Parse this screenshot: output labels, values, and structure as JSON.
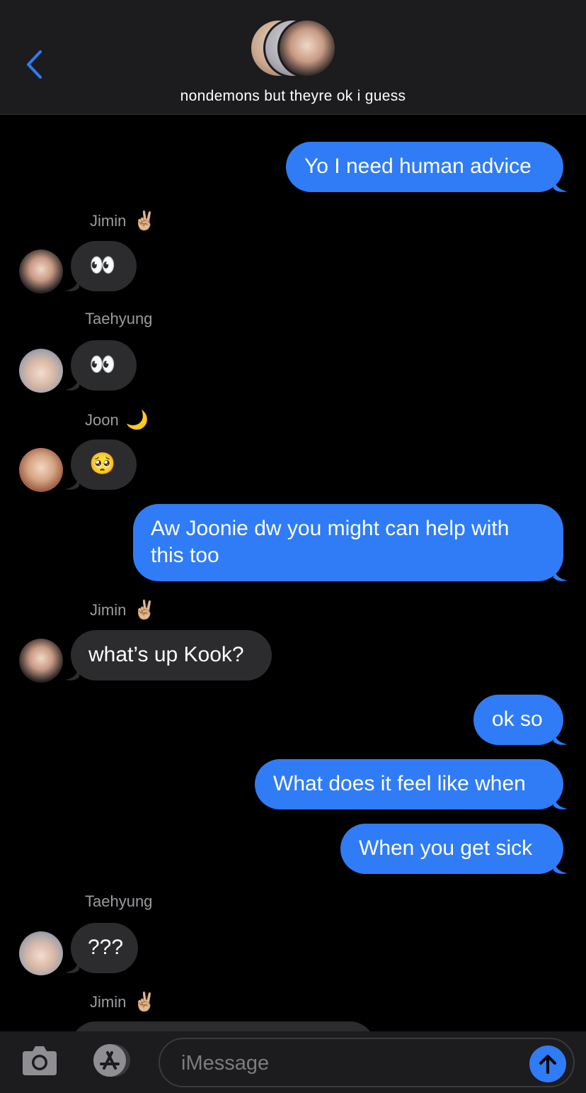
{
  "header": {
    "title": "nondemons but theyre ok i guess"
  },
  "messages": [
    {
      "text": "Yo I need human advice"
    },
    {
      "sender": "Jimin",
      "sender_emoji": "✌🏼",
      "text": "👀"
    },
    {
      "sender": "Taehyung",
      "text": "👀"
    },
    {
      "sender": "Joon",
      "sender_emoji": "🌙",
      "text": "🥺"
    },
    {
      "text_line1": "Aw Joonie dw you might can help with",
      "text_line2": "this too"
    },
    {
      "sender": "Jimin",
      "sender_emoji": "✌🏼",
      "text": "what’s up Kook?"
    },
    {
      "text": "ok so"
    },
    {
      "text": "What does it feel like when"
    },
    {
      "text": "When you get sick"
    },
    {
      "sender": "Taehyung",
      "text": "???"
    },
    {
      "sender": "Jimin",
      "sender_emoji": "✌🏼"
    }
  ],
  "composer": {
    "placeholder": "iMessage"
  },
  "colors": {
    "outgoing_bubble": "#2f7cf6",
    "incoming_bubble": "#2c2c2e",
    "accent": "#2f7cf6"
  },
  "icons": [
    "back-chevron-icon",
    "camera-icon",
    "app-store-icon",
    "send-arrow-icon"
  ]
}
